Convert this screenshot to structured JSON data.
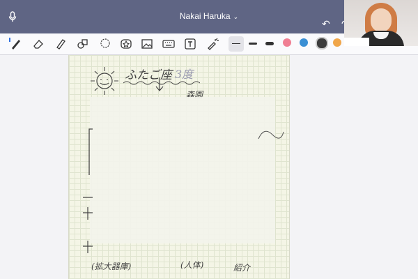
{
  "window": {
    "title": "Nakai Haruka"
  },
  "icons": {
    "mic": "microphone-icon",
    "title_chevron": "chevron-down-icon",
    "undo": "undo-icon",
    "redo": "redo-icon"
  },
  "toolbar": {
    "tools": [
      "pen-icon",
      "eraser-icon",
      "highlighter-icon",
      "shapes-icon",
      "lasso-icon",
      "sticker-icon",
      "image-icon",
      "keyboard-icon",
      "text-box-icon",
      "laser-pointer-icon"
    ],
    "stroke_widths": [
      "thin",
      "medium",
      "thick"
    ],
    "selected_width": "thin",
    "colors": [
      "#f07f93",
      "#3a8fd4",
      "#3c3c3c",
      "#f0a64a"
    ],
    "selected_color": "#3c3c3c"
  },
  "document": {
    "heading": "ふたご座",
    "heading_suffix": "3度",
    "line_2": "森園",
    "note_bottom_left": "(拡大器庫)",
    "note_bottom_mid": "(人体)",
    "note_bottom_right": "紹介"
  }
}
